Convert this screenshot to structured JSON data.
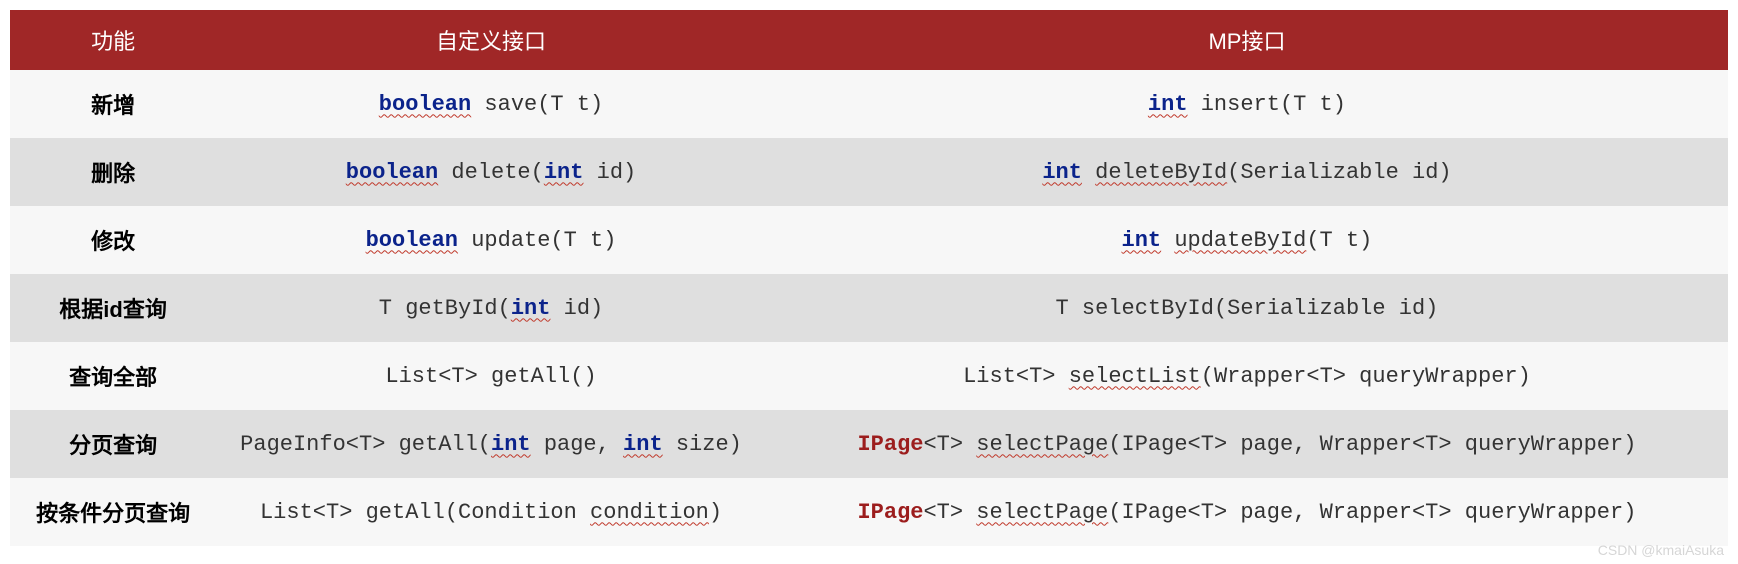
{
  "headers": [
    "功能",
    "自定义接口",
    "MP接口"
  ],
  "rows": [
    {
      "feature": "新增",
      "custom": [
        {
          "t": "boolean",
          "c": "kw"
        },
        {
          "t": " save(T t)"
        }
      ],
      "mp": [
        {
          "t": "int",
          "c": "kw"
        },
        {
          "t": " insert(T t)"
        }
      ]
    },
    {
      "feature": "删除",
      "custom": [
        {
          "t": "boolean",
          "c": "kw"
        },
        {
          "t": " delete("
        },
        {
          "t": "int",
          "c": "kw"
        },
        {
          "t": " id)"
        }
      ],
      "mp": [
        {
          "t": "int",
          "c": "kw"
        },
        {
          "t": " "
        },
        {
          "t": "deleteById",
          "c": "und"
        },
        {
          "t": "(Serializable id)"
        }
      ]
    },
    {
      "feature": "修改",
      "custom": [
        {
          "t": "boolean",
          "c": "kw"
        },
        {
          "t": " update(T t)"
        }
      ],
      "mp": [
        {
          "t": "int",
          "c": "kw"
        },
        {
          "t": " "
        },
        {
          "t": "updateById",
          "c": "und"
        },
        {
          "t": "(T t)"
        }
      ]
    },
    {
      "feature": "根据id查询",
      "custom": [
        {
          "t": "T getById("
        },
        {
          "t": "int",
          "c": "kw"
        },
        {
          "t": " id)"
        }
      ],
      "mp": [
        {
          "t": "T selectById(Serializable id)"
        }
      ]
    },
    {
      "feature": "查询全部",
      "custom": [
        {
          "t": "List<T> getAll()"
        }
      ],
      "mp": [
        {
          "t": "List<T> "
        },
        {
          "t": "selectList",
          "c": "und"
        },
        {
          "t": "(Wrapper<T> queryWrapper)"
        }
      ]
    },
    {
      "feature": "分页查询",
      "custom": [
        {
          "t": "PageInfo<T> getAll("
        },
        {
          "t": "int",
          "c": "kw"
        },
        {
          "t": " page, "
        },
        {
          "t": "int",
          "c": "kw"
        },
        {
          "t": " size)"
        }
      ],
      "mp": [
        {
          "t": "IPage",
          "c": "err"
        },
        {
          "t": "<T> "
        },
        {
          "t": "selectPage",
          "c": "und"
        },
        {
          "t": "(IPage<T> page, Wrapper<T> queryWrapper)"
        }
      ]
    },
    {
      "feature": "按条件分页查询",
      "custom": [
        {
          "t": "List<T> getAll(Condition "
        },
        {
          "t": "condition",
          "c": "und"
        },
        {
          "t": ")"
        }
      ],
      "mp": [
        {
          "t": "IPage",
          "c": "err"
        },
        {
          "t": "<T> "
        },
        {
          "t": "selectPage",
          "c": "und"
        },
        {
          "t": "(IPage<T> page, Wrapper<T> queryWrapper)"
        }
      ]
    }
  ],
  "watermark": "CSDN @kmaiAsuka"
}
